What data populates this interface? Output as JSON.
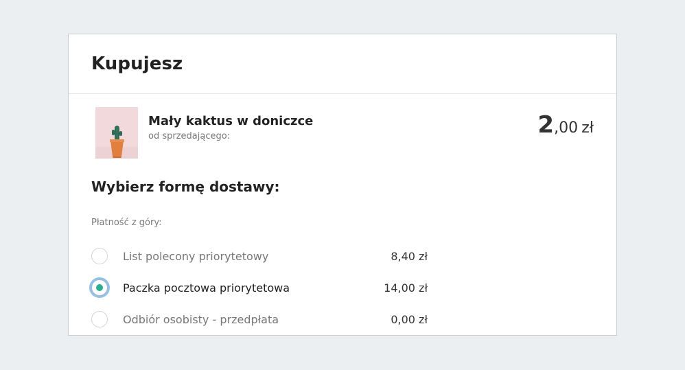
{
  "header": {
    "title": "Kupujesz"
  },
  "product": {
    "name": "Mały kaktus w doniczce",
    "seller_label": "od sprzedającego:",
    "price_integer": "2",
    "price_decimal": ",00",
    "currency": "zł",
    "image_icon": "cactus-icon"
  },
  "delivery": {
    "title": "Wybierz formę dostawy:",
    "group_label": "Płatność z góry:",
    "options": [
      {
        "label": "List polecony priorytetowy",
        "price": "8,40 zł",
        "selected": false
      },
      {
        "label": "Paczka pocztowa priorytetowa",
        "price": "14,00 zł",
        "selected": true
      },
      {
        "label": "Odbiór osobisty - przedpłata",
        "price": "0,00 zł",
        "selected": false
      }
    ]
  },
  "colors": {
    "page_background": "#eceff2",
    "radio_selected_dot": "#27b08e",
    "radio_focus_ring": "#8fc3ee"
  }
}
